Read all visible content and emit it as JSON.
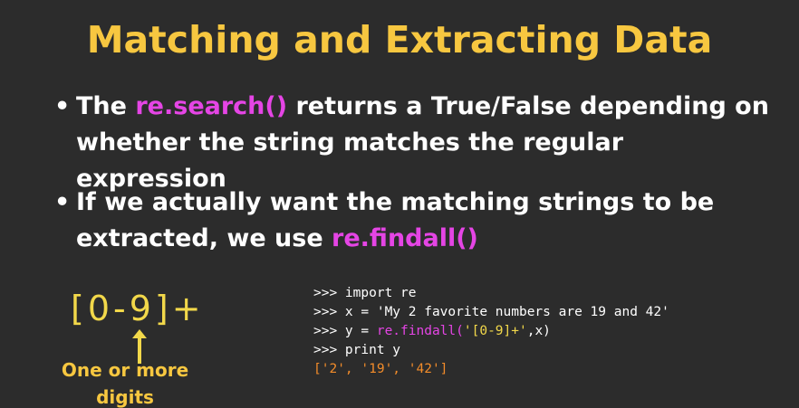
{
  "title": "Matching and Extracting Data",
  "bullets": [
    {
      "before": "The ",
      "highlight": "re.search()",
      "after": " returns a True/False depending on whether the string matches  the regular expression"
    },
    {
      "before": "If we actually want the matching strings to be extracted, we use ",
      "highlight": "re.findall()",
      "after": ""
    }
  ],
  "bullet_symbol": "•",
  "regex_example": "[0-9]+",
  "regex_caption": "One or more digits",
  "code": {
    "line1": ">>> import re",
    "line2": ">>> x = 'My 2 favorite numbers are 19 and 42'",
    "line3_prompt": ">>> y = ",
    "line3_fn": "re.findall(",
    "line3_arg": "'[0-9]+'",
    "line3_rest": ",x)",
    "line4": ">>> print y",
    "line5": "['2', '19', '42']"
  },
  "colors": {
    "background": "#2c2c2c",
    "title": "#f7c740",
    "highlight": "#e545e5",
    "regex": "#f2d84a",
    "output": "#f28c2a",
    "text": "#ffffff"
  },
  "icons": {
    "arrow": "arrow-up-icon"
  }
}
